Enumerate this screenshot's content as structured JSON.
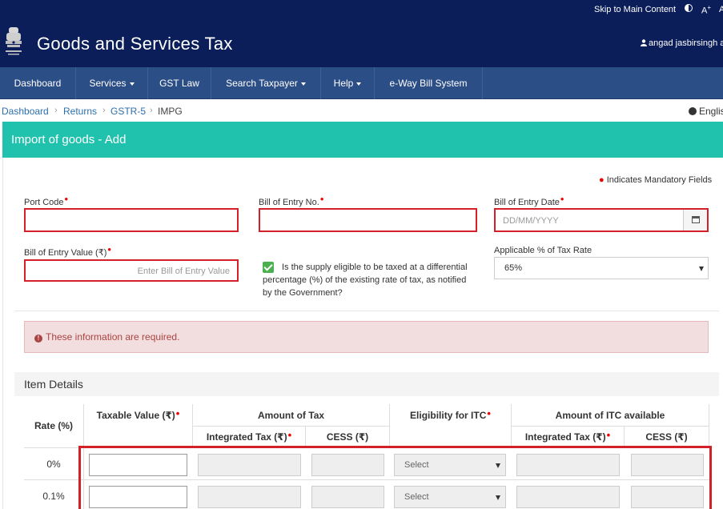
{
  "topbar": {
    "skip_link": "Skip to Main Content",
    "font_increase": "A",
    "font_increase_sup": "+",
    "font_decrease": "A"
  },
  "header": {
    "title": "Goods and Services Tax",
    "user_name": "angad jasbirsingh a"
  },
  "nav": {
    "items": [
      {
        "label": "Dashboard"
      },
      {
        "label": "Services"
      },
      {
        "label": "GST Law"
      },
      {
        "label": "Search Taxpayer"
      },
      {
        "label": "Help"
      },
      {
        "label": "e-Way Bill System"
      }
    ]
  },
  "breadcrumb": {
    "items": [
      "Dashboard",
      "Returns",
      "GSTR-5",
      "IMPG"
    ],
    "separator": "›",
    "language": "Englis"
  },
  "panel": {
    "title": "Import of goods - Add",
    "mandatory_note": "Indicates Mandatory Fields"
  },
  "form": {
    "port_code_label": "Port Code",
    "boe_no_label": "Bill of Entry No.",
    "boe_date_label": "Bill of Entry Date",
    "boe_date_placeholder": "DD/MM/YYYY",
    "boe_value_label": "Bill of Entry Value (₹)",
    "boe_value_placeholder": "Enter Bill of Entry Value",
    "differential_checkbox_label": "Is the supply eligible to be taxed at a differential percentage (%) of the existing rate of tax, as notified by the Government?",
    "differential_checked": true,
    "tax_rate_label": "Applicable % of Tax Rate",
    "tax_rate_value": "65%"
  },
  "alert": {
    "message": "These information are required."
  },
  "items": {
    "section_title": "Item Details",
    "headers": {
      "rate": "Rate (%)",
      "taxable_value": "Taxable Value (₹)",
      "amount_of_tax": "Amount of Tax",
      "eligibility": "Eligibility for ITC",
      "amount_itc": "Amount of ITC available",
      "integrated_tax": "Integrated Tax (₹)",
      "cess": "CESS (₹)",
      "itc_integrated_tax": "Integrated Tax (₹)",
      "itc_cess": "CESS (₹)"
    },
    "rows": [
      {
        "rate": "0%",
        "eligibility": "Select"
      },
      {
        "rate": "0.1%",
        "eligibility": "Select"
      }
    ]
  },
  "colors": {
    "header_bg": "#0b1e59",
    "nav_bg": "#2c4e86",
    "panel_head_bg": "#21c2ad",
    "error_border": "#d42029",
    "alert_bg": "#f2dede",
    "link": "#2c6fad"
  }
}
